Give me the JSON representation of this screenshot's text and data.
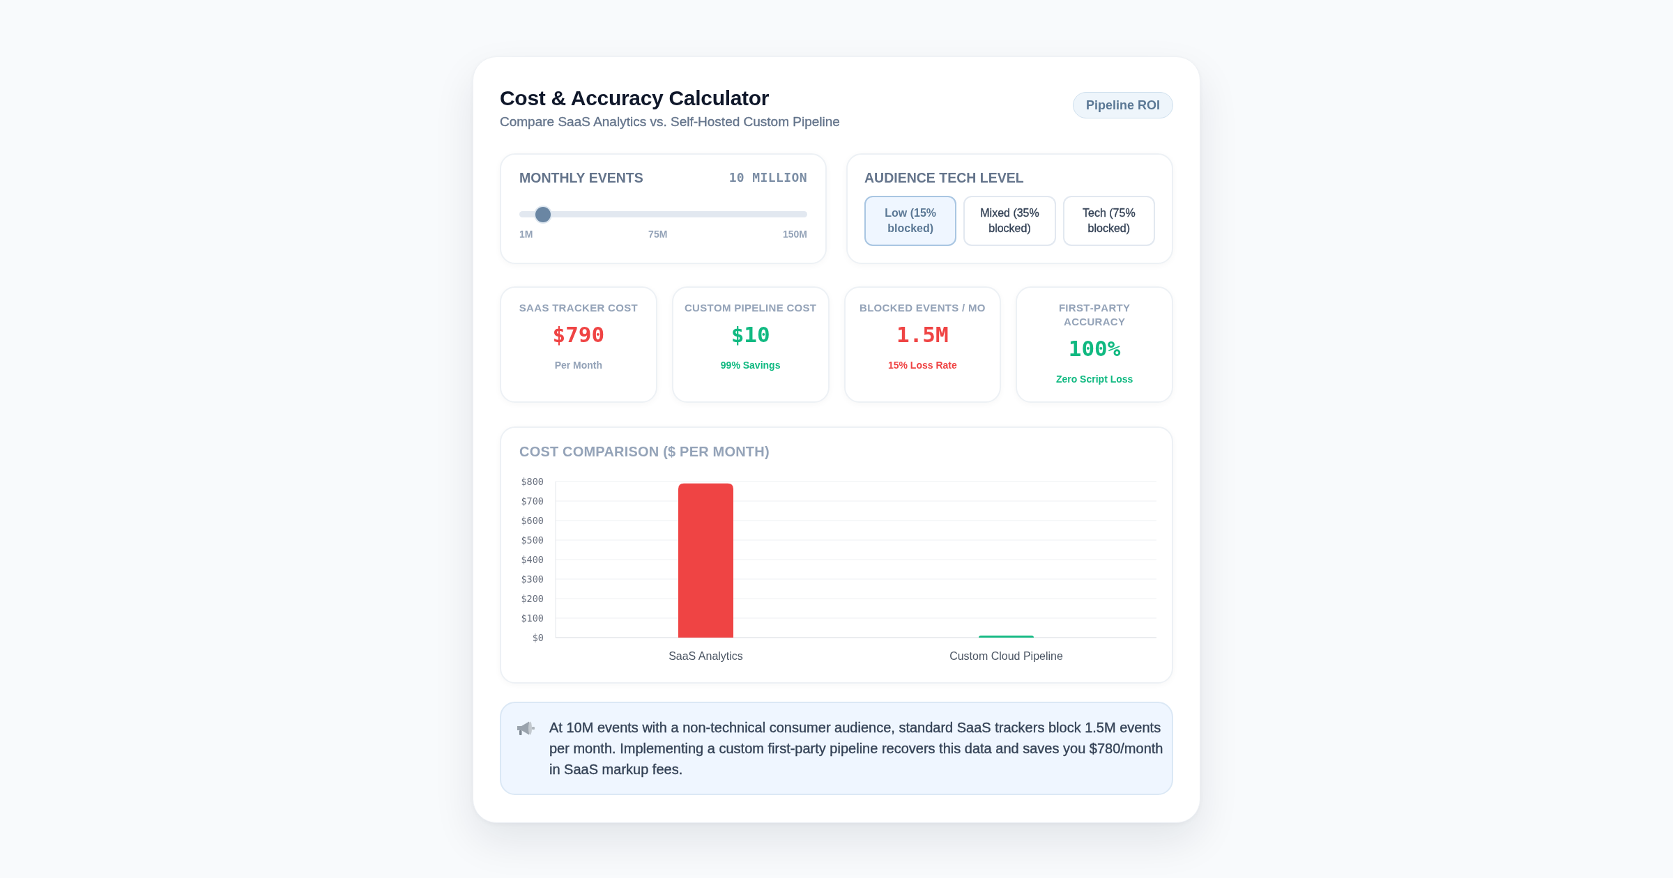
{
  "header": {
    "title": "Cost & Accuracy Calculator",
    "subtitle": "Compare SaaS Analytics vs. Self-Hosted Custom Pipeline",
    "badge": "Pipeline ROI"
  },
  "events": {
    "label": "MONTHLY EVENTS",
    "reading": "10 MILLION",
    "level": 0.06,
    "ticks": [
      "1M",
      "75M",
      "150M"
    ]
  },
  "audience": {
    "label": "AUDIENCE TECH LEVEL",
    "options": [
      {
        "label": "Low (15% blocked)",
        "selected": true
      },
      {
        "label": "Mixed (35% blocked)",
        "selected": false
      },
      {
        "label": "Tech (75% blocked)",
        "selected": false
      }
    ]
  },
  "metrics": [
    {
      "label": "SAAS TRACKER COST",
      "value": {
        "text": "$790",
        "color": "#ef4444"
      },
      "note": {
        "text": "Per Month",
        "color": "#94a3b8"
      }
    },
    {
      "label": "CUSTOM PIPELINE COST",
      "value": {
        "text": "$10",
        "color": "#10b981"
      },
      "note": {
        "text": "99% Savings",
        "color": "#10b981"
      }
    },
    {
      "label": "BLOCKED EVENTS / MO",
      "value": {
        "text": "1.5M",
        "color": "#ef4444"
      },
      "note": {
        "text": "15% Loss Rate",
        "color": "#ef4444"
      }
    },
    {
      "label": "FIRST-PARTY ACCURACY",
      "value": {
        "text": "100%",
        "color": "#10b981"
      },
      "note": {
        "text": "Zero Script Loss",
        "color": "#10b981"
      }
    }
  ],
  "chart": {
    "chart_data": {
      "type": "bar",
      "title": "COST COMPARISON ($ PER MONTH)",
      "categories": [
        "SaaS Analytics",
        "Custom Cloud Pipeline"
      ],
      "values": [
        790,
        10
      ],
      "colors": [
        "#ef4444",
        "#10b981"
      ],
      "ylim": [
        0,
        800
      ],
      "yticks": [
        {
          "value": 0,
          "label": "$0"
        },
        {
          "value": 100,
          "label": "$100"
        },
        {
          "value": 200,
          "label": "$200"
        },
        {
          "value": 300,
          "label": "$300"
        },
        {
          "value": 400,
          "label": "$400"
        },
        {
          "value": 500,
          "label": "$500"
        },
        {
          "value": 600,
          "label": "$600"
        },
        {
          "value": 700,
          "label": "$700"
        },
        {
          "value": 800,
          "label": "$800"
        }
      ],
      "grid": true
    }
  },
  "note": {
    "text": "At 10M events with a non-technical consumer audience, standard SaaS trackers block 1.5M events per month. Implementing a custom first-party pipeline recovers this data and saves you $780/month in SaaS markup fees."
  }
}
